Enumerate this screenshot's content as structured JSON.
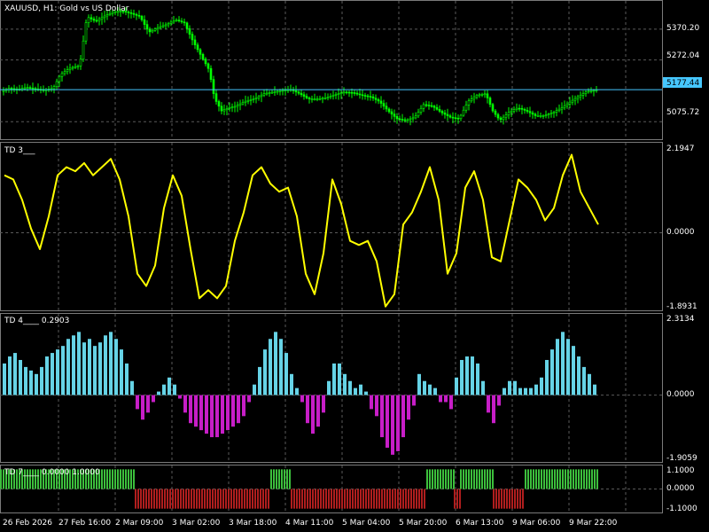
{
  "window": {
    "symbol_label": "XAUUSD, H1:  Gold vs US Dollar",
    "current_price": "5177.44"
  },
  "colors": {
    "background": "#000000",
    "grid": "#5a5a5a",
    "candle_up": "#00ff00",
    "current_price_line": "#46c7ff",
    "osc_line": "#ffff00",
    "hist_positive": "#66d3e6",
    "hist_negative": "#c71ec7",
    "bar_positive": "#3cbf3c",
    "bar_negative": "#b01e1e"
  },
  "panels": [
    {
      "id": "price",
      "title": "XAUUSD, H1:  Gold vs US Dollar",
      "axis_labels": [
        "5370.20",
        "5272.04",
        "5075.72"
      ]
    },
    {
      "id": "td3",
      "title": "TD 3___",
      "axis_labels": [
        "2.1947",
        "0.0000",
        "-1.8931"
      ]
    },
    {
      "id": "td4",
      "title": "TD 4____  0.2903",
      "axis_labels": [
        "2.3134",
        "0.0000",
        "-1.9059"
      ]
    },
    {
      "id": "td7",
      "title": "TD 7____  0.0000  1.0000",
      "axis_labels": [
        "1.1000",
        "0.0000",
        "-1.1000"
      ]
    }
  ],
  "time_labels": [
    "26 Feb 2026",
    "27 Feb 16:00",
    "2 Mar 09:00",
    "3 Mar 02:00",
    "3 Mar 18:00",
    "4 Mar 11:00",
    "5 Mar 04:00",
    "5 Mar 20:00",
    "6 Mar 13:00",
    "9 Mar 06:00",
    "9 Mar 22:00"
  ],
  "chart_data": [
    {
      "type": "candlestick",
      "title": "XAUUSD, H1:  Gold vs US Dollar",
      "ylim": [
        5020,
        5460
      ],
      "y_ticks": [
        5370.2,
        5272.04,
        5075.72
      ],
      "current_price": 5177.44,
      "close_path": [
        [
          0,
          5170
        ],
        [
          10,
          5182
        ],
        [
          20,
          5178
        ],
        [
          30,
          5185
        ],
        [
          40,
          5180
        ],
        [
          50,
          5176
        ],
        [
          60,
          5182
        ],
        [
          68,
          5225
        ],
        [
          78,
          5245
        ],
        [
          90,
          5255
        ],
        [
          98,
          5410
        ],
        [
          108,
          5395
        ],
        [
          118,
          5412
        ],
        [
          128,
          5425
        ],
        [
          138,
          5428
        ],
        [
          148,
          5420
        ],
        [
          158,
          5410
        ],
        [
          168,
          5360
        ],
        [
          178,
          5375
        ],
        [
          188,
          5385
        ],
        [
          198,
          5400
        ],
        [
          208,
          5390
        ],
        [
          218,
          5330
        ],
        [
          228,
          5280
        ],
        [
          236,
          5240
        ],
        [
          242,
          5150
        ],
        [
          250,
          5110
        ],
        [
          258,
          5120
        ],
        [
          266,
          5125
        ],
        [
          276,
          5140
        ],
        [
          288,
          5150
        ],
        [
          298,
          5165
        ],
        [
          308,
          5170
        ],
        [
          318,
          5175
        ],
        [
          328,
          5178
        ],
        [
          338,
          5165
        ],
        [
          348,
          5148
        ],
        [
          358,
          5148
        ],
        [
          368,
          5152
        ],
        [
          378,
          5162
        ],
        [
          388,
          5170
        ],
        [
          398,
          5168
        ],
        [
          408,
          5160
        ],
        [
          418,
          5155
        ],
        [
          428,
          5140
        ],
        [
          438,
          5110
        ],
        [
          448,
          5085
        ],
        [
          458,
          5080
        ],
        [
          468,
          5090
        ],
        [
          478,
          5130
        ],
        [
          488,
          5125
        ],
        [
          498,
          5105
        ],
        [
          508,
          5090
        ],
        [
          518,
          5085
        ],
        [
          528,
          5140
        ],
        [
          538,
          5160
        ],
        [
          548,
          5165
        ],
        [
          556,
          5110
        ],
        [
          564,
          5080
        ],
        [
          574,
          5105
        ],
        [
          584,
          5120
        ],
        [
          594,
          5110
        ],
        [
          604,
          5095
        ],
        [
          614,
          5095
        ],
        [
          624,
          5105
        ],
        [
          634,
          5120
        ],
        [
          644,
          5140
        ],
        [
          652,
          5155
        ],
        [
          662,
          5172
        ],
        [
          674,
          5177
        ]
      ]
    },
    {
      "type": "line",
      "title": "TD 3___",
      "ylim": [
        -1.8931,
        2.1947
      ],
      "y_ticks": [
        2.1947,
        0,
        -1.8931
      ],
      "series": [
        {
          "points": [
            [
              5,
              1.4
            ],
            [
              15,
              1.3
            ],
            [
              25,
              0.8
            ],
            [
              35,
              0.1
            ],
            [
              45,
              -0.4
            ],
            [
              55,
              0.4
            ],
            [
              65,
              1.4
            ],
            [
              75,
              1.6
            ],
            [
              85,
              1.5
            ],
            [
              95,
              1.7
            ],
            [
              105,
              1.4
            ],
            [
              115,
              1.6
            ],
            [
              125,
              1.8
            ],
            [
              135,
              1.3
            ],
            [
              145,
              0.4
            ],
            [
              155,
              -1.0
            ],
            [
              165,
              -1.3
            ],
            [
              175,
              -0.8
            ],
            [
              185,
              0.6
            ],
            [
              195,
              1.4
            ],
            [
              205,
              0.9
            ],
            [
              215,
              -0.4
            ],
            [
              225,
              -1.6
            ],
            [
              235,
              -1.4
            ],
            [
              245,
              -1.6
            ],
            [
              255,
              -1.3
            ],
            [
              265,
              -0.2
            ],
            [
              275,
              0.5
            ],
            [
              285,
              1.4
            ],
            [
              295,
              1.6
            ],
            [
              305,
              1.2
            ],
            [
              315,
              1.0
            ],
            [
              325,
              1.1
            ],
            [
              335,
              0.4
            ],
            [
              345,
              -1.0
            ],
            [
              355,
              -1.5
            ],
            [
              365,
              -0.5
            ],
            [
              375,
              1.3
            ],
            [
              385,
              0.7
            ],
            [
              395,
              -0.2
            ],
            [
              405,
              -0.3
            ],
            [
              415,
              -0.2
            ],
            [
              425,
              -0.7
            ],
            [
              435,
              -1.8
            ],
            [
              445,
              -1.5
            ],
            [
              455,
              0.2
            ],
            [
              465,
              0.5
            ],
            [
              475,
              1.0
            ],
            [
              485,
              1.6
            ],
            [
              495,
              0.8
            ],
            [
              505,
              -1.0
            ],
            [
              515,
              -0.5
            ],
            [
              525,
              1.1
            ],
            [
              535,
              1.5
            ],
            [
              545,
              0.8
            ],
            [
              555,
              -0.6
            ],
            [
              565,
              -0.7
            ],
            [
              575,
              0.3
            ],
            [
              585,
              1.3
            ],
            [
              595,
              1.1
            ],
            [
              605,
              0.8
            ],
            [
              615,
              0.3
            ],
            [
              625,
              0.6
            ],
            [
              635,
              1.4
            ],
            [
              645,
              1.9
            ],
            [
              655,
              1.0
            ],
            [
              665,
              0.6
            ],
            [
              675,
              0.2
            ]
          ]
        }
      ]
    },
    {
      "type": "histogram",
      "title": "TD 4____  0.2903",
      "ylim": [
        -1.9059,
        2.3134
      ],
      "y_ticks": [
        2.3134,
        0,
        -1.9059
      ],
      "series": [
        {
          "x": [
            5,
            11,
            17,
            23,
            29,
            35,
            41,
            47,
            53,
            59,
            65,
            71,
            77,
            83,
            89,
            95,
            101,
            107,
            113,
            119,
            125,
            131,
            137,
            143,
            149,
            155,
            161,
            167,
            173,
            179,
            185,
            191,
            197,
            203,
            209,
            215,
            221,
            227,
            233,
            239,
            245,
            251,
            257,
            263,
            269,
            275,
            281,
            287,
            293,
            299,
            305,
            311,
            317,
            323,
            329,
            335,
            341,
            347,
            353,
            359,
            365,
            371,
            377,
            383,
            389,
            395,
            401,
            407,
            413,
            419,
            425,
            431,
            437,
            443,
            449,
            455,
            461,
            467,
            473,
            479,
            485,
            491,
            497,
            503,
            509,
            515,
            521,
            527,
            533,
            539,
            545,
            551,
            557,
            563,
            569,
            575,
            581,
            587,
            593,
            599,
            605,
            611,
            617,
            623,
            629,
            635,
            641,
            647,
            653,
            659,
            665,
            671
          ],
          "values": [
            0.9,
            1.1,
            1.2,
            1.0,
            0.8,
            0.7,
            0.6,
            0.8,
            1.1,
            1.2,
            1.3,
            1.4,
            1.6,
            1.7,
            1.8,
            1.5,
            1.6,
            1.4,
            1.5,
            1.7,
            1.8,
            1.6,
            1.3,
            0.9,
            0.4,
            -0.4,
            -0.7,
            -0.5,
            -0.2,
            0.1,
            0.3,
            0.5,
            0.3,
            -0.1,
            -0.5,
            -0.8,
            -0.9,
            -1.0,
            -1.1,
            -1.2,
            -1.2,
            -1.1,
            -1.0,
            -0.9,
            -0.8,
            -0.6,
            -0.2,
            0.3,
            0.8,
            1.3,
            1.6,
            1.8,
            1.6,
            1.2,
            0.6,
            0.2,
            -0.2,
            -0.8,
            -1.1,
            -0.9,
            -0.5,
            0.4,
            0.9,
            0.9,
            0.6,
            0.4,
            0.2,
            0.3,
            0.1,
            -0.4,
            -0.6,
            -1.2,
            -1.5,
            -1.7,
            -1.6,
            -1.2,
            -0.7,
            -0.3,
            0.6,
            0.4,
            0.3,
            0.2,
            -0.2,
            -0.2,
            -0.4,
            0.5,
            1.0,
            1.1,
            1.1,
            0.9,
            0.4,
            -0.5,
            -0.8,
            -0.3,
            0.2,
            0.4,
            0.4,
            0.2,
            0.2,
            0.2,
            0.3,
            0.5,
            1.0,
            1.3,
            1.6,
            1.8,
            1.6,
            1.4,
            1.1,
            0.8,
            0.6,
            0.3
          ]
        }
      ]
    },
    {
      "type": "histogram",
      "title": "TD 7____  0.0000  1.0000",
      "ylim": [
        -1.1,
        1.1
      ],
      "y_ticks": [
        1.1,
        0,
        -1.1
      ],
      "segments": [
        {
          "from": 0,
          "to": 152,
          "value": 1
        },
        {
          "from": 152,
          "to": 305,
          "value": -1
        },
        {
          "from": 305,
          "to": 328,
          "value": 1
        },
        {
          "from": 328,
          "to": 481,
          "value": -1
        },
        {
          "from": 481,
          "to": 512,
          "value": 1
        },
        {
          "from": 512,
          "to": 519,
          "value": -1
        },
        {
          "from": 519,
          "to": 556,
          "value": 1
        },
        {
          "from": 556,
          "to": 592,
          "value": -1
        },
        {
          "from": 592,
          "to": 676,
          "value": 1
        }
      ]
    }
  ]
}
